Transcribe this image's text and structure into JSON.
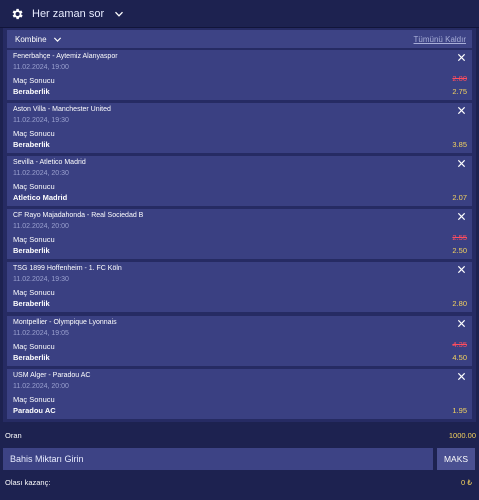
{
  "top": {
    "label": "Her zaman sor",
    "icon": "gear-icon"
  },
  "slip": {
    "mode": "Kombine",
    "remove_all": "Tümünü Kaldır"
  },
  "bets": [
    {
      "match": "Fenerbahçe - Aytemiz Alanyaspor",
      "date": "11.02.2024, 19:00",
      "market": "Maç Sonucu",
      "pick": "Beraberlik",
      "old_odd": "2.80",
      "odd": "2.75"
    },
    {
      "match": "Aston Villa - Manchester United",
      "date": "11.02.2024, 19:30",
      "market": "Maç Sonucu",
      "pick": "Beraberlik",
      "old_odd": "",
      "odd": "3.85"
    },
    {
      "match": "Sevilla - Atletico Madrid",
      "date": "11.02.2024, 20:30",
      "market": "Maç Sonucu",
      "pick": "Atletico Madrid",
      "old_odd": "",
      "odd": "2.07"
    },
    {
      "match": "CF Rayo Majadahonda - Real Sociedad B",
      "date": "11.02.2024, 20:00",
      "market": "Maç Sonucu",
      "pick": "Beraberlik",
      "old_odd": "2.55",
      "odd": "2.50"
    },
    {
      "match": "TSG 1899 Hoffenheim - 1. FC Köln",
      "date": "11.02.2024, 19:30",
      "market": "Maç Sonucu",
      "pick": "Beraberlik",
      "old_odd": "",
      "odd": "2.80"
    },
    {
      "match": "Montpellier - Olympique Lyonnais",
      "date": "11.02.2024, 19:05",
      "market": "Maç Sonucu",
      "pick": "Beraberlik",
      "old_odd": "4.35",
      "odd": "4.50"
    },
    {
      "match": "USM Alger - Paradou AC",
      "date": "11.02.2024, 20:00",
      "market": "Maç Sonucu",
      "pick": "Paradou AC",
      "old_odd": "",
      "odd": "1.95"
    }
  ],
  "summary": {
    "total_label": "Oran",
    "total_value": "1000.00",
    "stake_placeholder": "Bahis Miktarı Girin",
    "max_label": "MAKS",
    "win_label": "Olası kazanç:",
    "win_value": "0 ₺"
  },
  "colors": {
    "background": "#1d2250",
    "card": "#3a4082",
    "odd": "#f4d35e",
    "old_odd": "#ff4d5e"
  }
}
